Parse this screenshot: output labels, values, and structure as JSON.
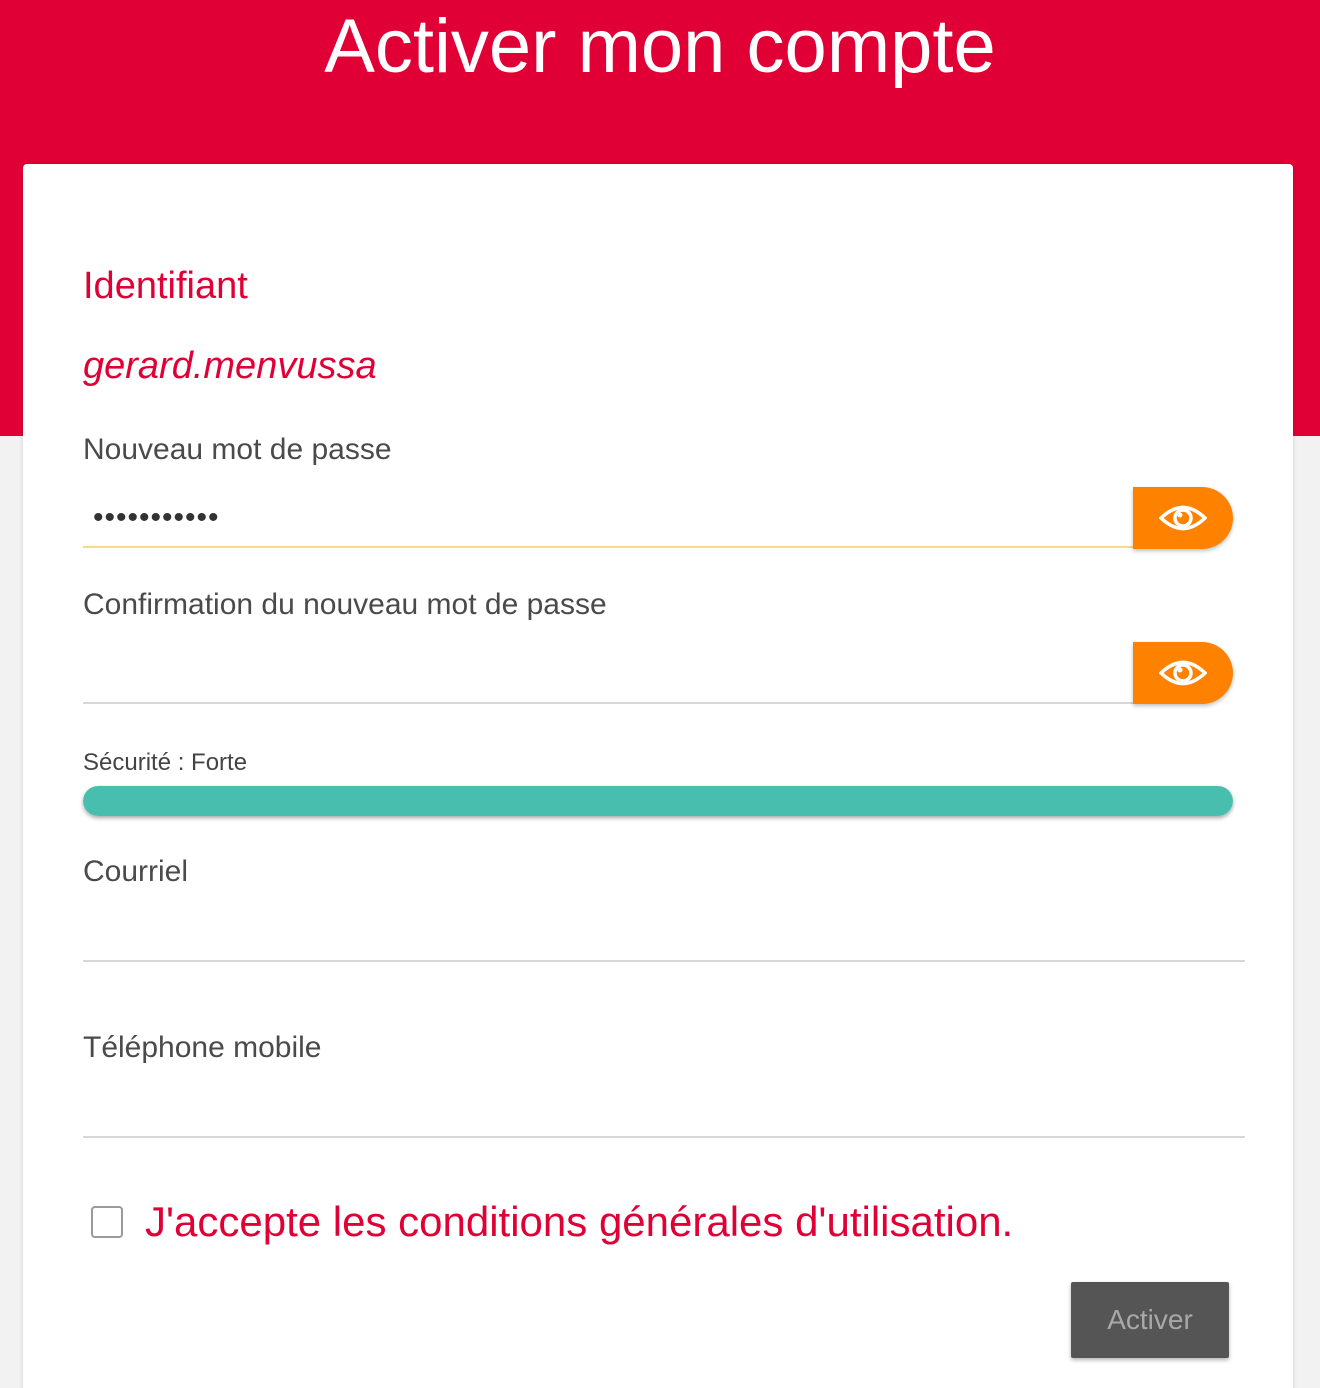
{
  "header": {
    "title": "Activer mon compte"
  },
  "identifier": {
    "label": "Identifiant",
    "value": "gerard.menvussa"
  },
  "new_password": {
    "label": "Nouveau mot de passe",
    "value": "•••••••••••"
  },
  "confirm_password": {
    "label": "Confirmation du nouveau mot de passe",
    "value": ""
  },
  "strength": {
    "label": "Sécurité : Forte",
    "level_percent": 100,
    "color": "#48beae"
  },
  "email": {
    "label": "Courriel",
    "value": ""
  },
  "mobile": {
    "label": "Téléphone mobile",
    "value": ""
  },
  "terms": {
    "label": "J'accepte les conditions générales d'utilisation.",
    "checked": false
  },
  "submit": {
    "label": "Activer"
  },
  "colors": {
    "brand": "#e10035",
    "eye_button": "#ff8100",
    "submit_disabled": "#555555"
  },
  "icons": {
    "password_toggle": "eye-icon"
  }
}
